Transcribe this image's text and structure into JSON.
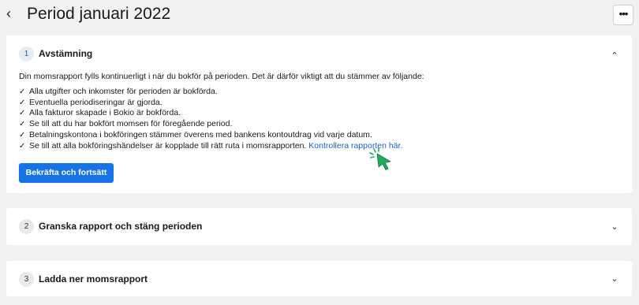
{
  "header": {
    "back_icon": "chevron-left-icon",
    "back_glyph": "‹",
    "title": "Period januari 2022",
    "more_icon": "more-horizontal-icon",
    "more_glyph": "•••"
  },
  "steps": [
    {
      "number": "1",
      "title": "Avstämning",
      "expanded": true,
      "chevron_glyph": "⌃",
      "intro": "Din momsrapport fylls kontinuerligt i när du bokför på perioden. Det är därför viktigt att du stämmer av följande:",
      "check_glyph": "✓",
      "checklist": [
        "Alla utgifter och inkomster för perioden är bokförda.",
        "Eventuella periodiseringar är gjorda.",
        "Alla fakturor skapade i Bokio är bokförda.",
        "Se till att du har bokfört momsen för föregående period.",
        "Betalningskontona i bokföringen stämmer överens med bankens kontoutdrag vid varje datum.",
        "Se till att alla bokföringshändelser är kopplade till rätt ruta i momsrapporten."
      ],
      "link_text": "Kontrollera rapporten här.",
      "confirm_label": "Bekräfta och fortsätt"
    },
    {
      "number": "2",
      "title": "Granska rapport och stäng perioden",
      "expanded": false,
      "chevron_glyph": "⌄"
    },
    {
      "number": "3",
      "title": "Ladda ner momsrapport",
      "expanded": false,
      "chevron_glyph": "⌄"
    }
  ],
  "colors": {
    "background": "#f1f1ef",
    "primary_button": "#1673e6",
    "link": "#1b62c8",
    "cursor": "#1fae5b"
  }
}
